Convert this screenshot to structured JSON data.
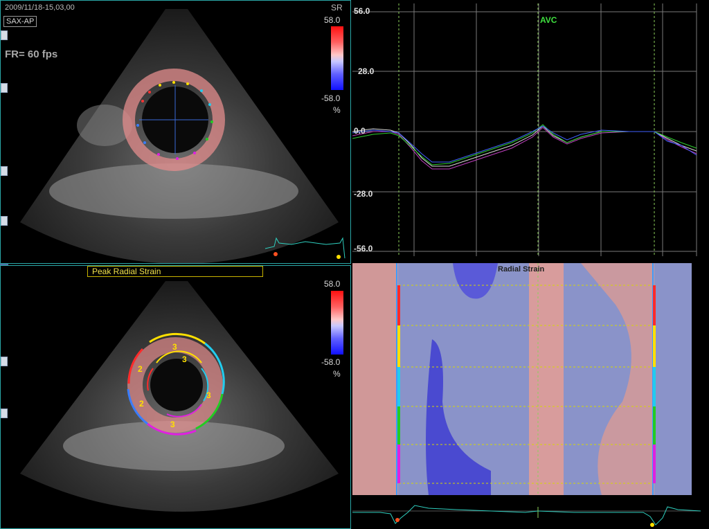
{
  "top_view": {
    "datetime": "2009/11/18-15,03,00",
    "view_label": "SAX-AP",
    "frame_rate": "FR=  60 fps",
    "mode": "SR",
    "scale_max": "58.0",
    "scale_min": "-58.0",
    "unit": "%"
  },
  "bottom_view": {
    "title": "Peak Radial Strain",
    "scale_max": "58.0",
    "scale_min": "-58.0",
    "unit": "%",
    "segment_labels": [
      "3",
      "2",
      "2",
      "3",
      "3",
      "3"
    ]
  },
  "graph": {
    "y_ticks": [
      "56.0",
      "28.0",
      "0.0",
      "-28.0",
      "-56.0"
    ],
    "marker": "AVC"
  },
  "heatmap": {
    "title": "Radial Strain"
  },
  "colors": {
    "frame_border": "#2aa8a8",
    "avc_green": "#3fe03f",
    "segment_colors": [
      "#ff2a2a",
      "#ffe000",
      "#22ccee",
      "#22cc22",
      "#e020e0",
      "#3a7dff"
    ]
  }
}
